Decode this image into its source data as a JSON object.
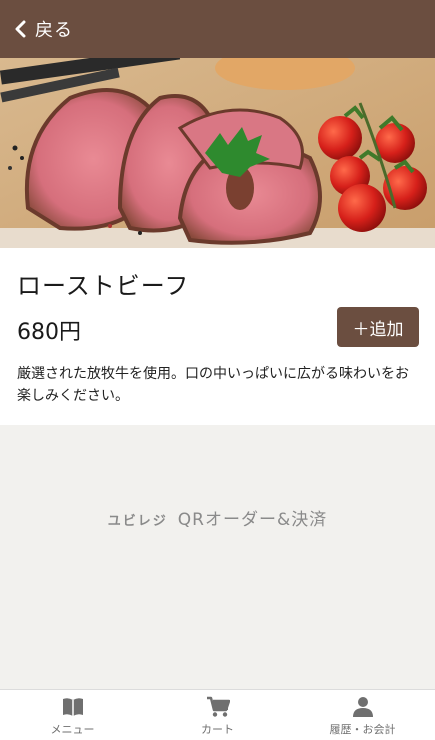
{
  "header": {
    "back_label": "戻る",
    "bg_color": "#6b4e40"
  },
  "item": {
    "name": "ローストビーフ",
    "price": "680円",
    "add_label": "＋追加",
    "description": "厳選された放牧牛を使用。口の中いっぱいに広がる味わいをお楽しみください。"
  },
  "footer": {
    "brand": "ユビレジ",
    "tagline": "QRオーダー&決済"
  },
  "tabbar": {
    "tabs": [
      {
        "label": "メニュー",
        "icon": "book-icon"
      },
      {
        "label": "カート",
        "icon": "cart-icon"
      },
      {
        "label": "履歴・お会計",
        "icon": "person-icon"
      }
    ]
  }
}
